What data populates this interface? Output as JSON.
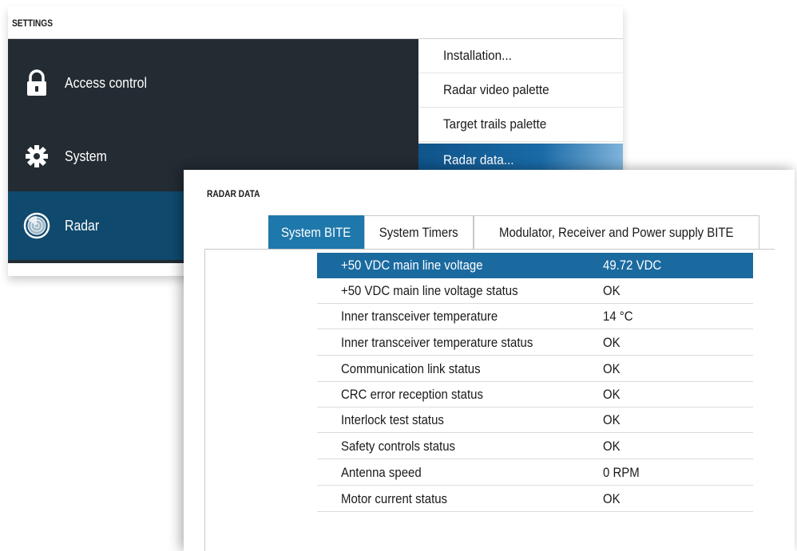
{
  "settings": {
    "title": "SETTINGS",
    "items": [
      {
        "label": "Access control",
        "icon": "lock-icon",
        "selected": false
      },
      {
        "label": "System",
        "icon": "gear-icon",
        "selected": false
      },
      {
        "label": "Radar",
        "icon": "radar-icon",
        "selected": true
      }
    ],
    "submenu": [
      {
        "label": "Installation...",
        "selected": false
      },
      {
        "label": "Radar video palette",
        "selected": false
      },
      {
        "label": "Target trails palette",
        "selected": false
      },
      {
        "label": "Radar data...",
        "selected": true
      }
    ]
  },
  "radar_data": {
    "title": "RADAR DATA",
    "tabs": [
      {
        "label": "System BITE",
        "active": true
      },
      {
        "label": "System Timers",
        "active": false
      },
      {
        "label": "Modulator, Receiver and Power supply BITE",
        "active": false
      }
    ],
    "rows": [
      {
        "name": "+50 VDC main line voltage",
        "value": "49.72 VDC",
        "selected": true
      },
      {
        "name": "+50 VDC main line voltage status",
        "value": "OK",
        "selected": false
      },
      {
        "name": "Inner transceiver temperature",
        "value": "14 °C",
        "selected": false
      },
      {
        "name": "Inner transceiver temperature  status",
        "value": "OK",
        "selected": false
      },
      {
        "name": "Communication link status",
        "value": "OK",
        "selected": false
      },
      {
        "name": "CRC error reception status",
        "value": "OK",
        "selected": false
      },
      {
        "name": "Interlock test status",
        "value": "OK",
        "selected": false
      },
      {
        "name": "Safety controls status",
        "value": "OK",
        "selected": false
      },
      {
        "name": "Antenna speed",
        "value": "0 RPM",
        "selected": false
      },
      {
        "name": "Motor current status",
        "value": "OK",
        "selected": false
      }
    ]
  },
  "colors": {
    "sidebar_bg": "#232b33",
    "selected_blue": "#0f4a6e",
    "tab_active": "#1f78ab",
    "row_selected": "#1a6aa0"
  }
}
